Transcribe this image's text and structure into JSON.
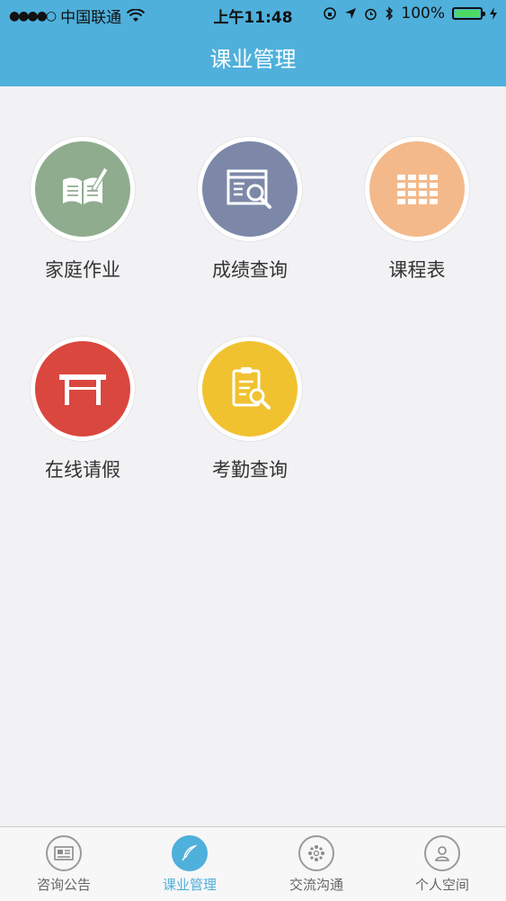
{
  "status_bar": {
    "carrier": "中国联通",
    "time": "上午11:48",
    "battery": "100%"
  },
  "nav": {
    "title": "课业管理"
  },
  "modules": [
    {
      "label": "家庭作业",
      "icon": "homework-book-icon",
      "color": "#8fac8f"
    },
    {
      "label": "成绩查询",
      "icon": "grade-search-icon",
      "color": "#7d88a8"
    },
    {
      "label": "课程表",
      "icon": "timetable-icon",
      "color": "#f3b98b"
    },
    {
      "label": "在线请假",
      "icon": "leave-desk-icon",
      "color": "#d9473f"
    },
    {
      "label": "考勤查询",
      "icon": "attendance-clipboard-icon",
      "color": "#f0c230"
    }
  ],
  "tabs": [
    {
      "label": "咨询公告",
      "icon": "news-icon",
      "active": false
    },
    {
      "label": "课业管理",
      "icon": "feather-icon",
      "active": true
    },
    {
      "label": "交流沟通",
      "icon": "chat-icon",
      "active": false
    },
    {
      "label": "个人空间",
      "icon": "person-icon",
      "active": false
    }
  ],
  "colors": {
    "accent": "#4fb0db",
    "background": "#f2f2f4"
  }
}
